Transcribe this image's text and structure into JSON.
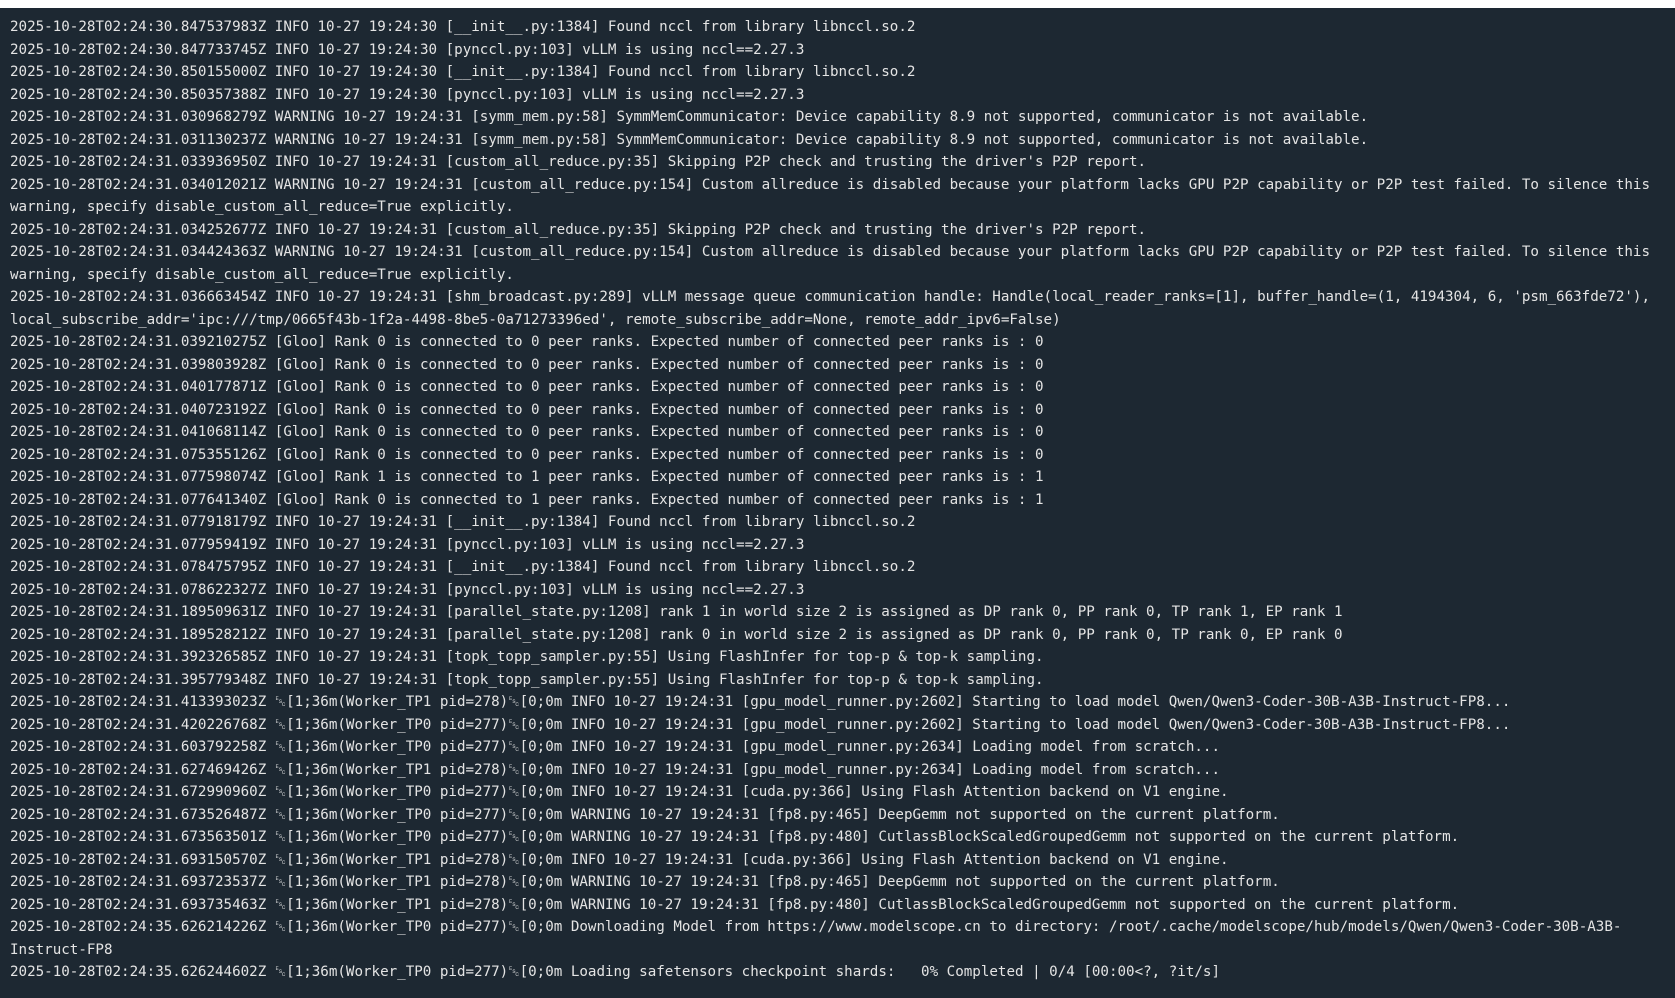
{
  "terminal": {
    "lines": [
      "2025-10-28T02:24:30.847537983Z INFO 10-27 19:24:30 [__init__.py:1384] Found nccl from library libnccl.so.2",
      "2025-10-28T02:24:30.847733745Z INFO 10-27 19:24:30 [pynccl.py:103] vLLM is using nccl==2.27.3",
      "2025-10-28T02:24:30.850155000Z INFO 10-27 19:24:30 [__init__.py:1384] Found nccl from library libnccl.so.2",
      "2025-10-28T02:24:30.850357388Z INFO 10-27 19:24:30 [pynccl.py:103] vLLM is using nccl==2.27.3",
      "2025-10-28T02:24:31.030968279Z WARNING 10-27 19:24:31 [symm_mem.py:58] SymmMemCommunicator: Device capability 8.9 not supported, communicator is not available.",
      "2025-10-28T02:24:31.031130237Z WARNING 10-27 19:24:31 [symm_mem.py:58] SymmMemCommunicator: Device capability 8.9 not supported, communicator is not available.",
      "2025-10-28T02:24:31.033936950Z INFO 10-27 19:24:31 [custom_all_reduce.py:35] Skipping P2P check and trusting the driver's P2P report.",
      "2025-10-28T02:24:31.034012021Z WARNING 10-27 19:24:31 [custom_all_reduce.py:154] Custom allreduce is disabled because your platform lacks GPU P2P capability or P2P test failed. To silence this",
      "warning, specify disable_custom_all_reduce=True explicitly.",
      "2025-10-28T02:24:31.034252677Z INFO 10-27 19:24:31 [custom_all_reduce.py:35] Skipping P2P check and trusting the driver's P2P report.",
      "2025-10-28T02:24:31.034424363Z WARNING 10-27 19:24:31 [custom_all_reduce.py:154] Custom allreduce is disabled because your platform lacks GPU P2P capability or P2P test failed. To silence this",
      "warning, specify disable_custom_all_reduce=True explicitly.",
      "2025-10-28T02:24:31.036663454Z INFO 10-27 19:24:31 [shm_broadcast.py:289] vLLM message queue communication handle: Handle(local_reader_ranks=[1], buffer_handle=(1, 4194304, 6, 'psm_663fde72'),",
      "local_subscribe_addr='ipc:///tmp/0665f43b-1f2a-4498-8be5-0a71273396ed', remote_subscribe_addr=None, remote_addr_ipv6=False)",
      "2025-10-28T02:24:31.039210275Z [Gloo] Rank 0 is connected to 0 peer ranks. Expected number of connected peer ranks is : 0",
      "2025-10-28T02:24:31.039803928Z [Gloo] Rank 0 is connected to 0 peer ranks. Expected number of connected peer ranks is : 0",
      "2025-10-28T02:24:31.040177871Z [Gloo] Rank 0 is connected to 0 peer ranks. Expected number of connected peer ranks is : 0",
      "2025-10-28T02:24:31.040723192Z [Gloo] Rank 0 is connected to 0 peer ranks. Expected number of connected peer ranks is : 0",
      "2025-10-28T02:24:31.041068114Z [Gloo] Rank 0 is connected to 0 peer ranks. Expected number of connected peer ranks is : 0",
      "2025-10-28T02:24:31.075355126Z [Gloo] Rank 0 is connected to 0 peer ranks. Expected number of connected peer ranks is : 0",
      "2025-10-28T02:24:31.077598074Z [Gloo] Rank 1 is connected to 1 peer ranks. Expected number of connected peer ranks is : 1",
      "2025-10-28T02:24:31.077641340Z [Gloo] Rank 0 is connected to 1 peer ranks. Expected number of connected peer ranks is : 1",
      "2025-10-28T02:24:31.077918179Z INFO 10-27 19:24:31 [__init__.py:1384] Found nccl from library libnccl.so.2",
      "2025-10-28T02:24:31.077959419Z INFO 10-27 19:24:31 [pynccl.py:103] vLLM is using nccl==2.27.3",
      "2025-10-28T02:24:31.078475795Z INFO 10-27 19:24:31 [__init__.py:1384] Found nccl from library libnccl.so.2",
      "2025-10-28T02:24:31.078622327Z INFO 10-27 19:24:31 [pynccl.py:103] vLLM is using nccl==2.27.3",
      "2025-10-28T02:24:31.189509631Z INFO 10-27 19:24:31 [parallel_state.py:1208] rank 1 in world size 2 is assigned as DP rank 0, PP rank 0, TP rank 1, EP rank 1",
      "2025-10-28T02:24:31.189528212Z INFO 10-27 19:24:31 [parallel_state.py:1208] rank 0 in world size 2 is assigned as DP rank 0, PP rank 0, TP rank 0, EP rank 0",
      "2025-10-28T02:24:31.392326585Z INFO 10-27 19:24:31 [topk_topp_sampler.py:55] Using FlashInfer for top-p & top-k sampling.",
      "2025-10-28T02:24:31.395779348Z INFO 10-27 19:24:31 [topk_topp_sampler.py:55] Using FlashInfer for top-p & top-k sampling.",
      "2025-10-28T02:24:31.413393023Z ␛[1;36m(Worker_TP1 pid=278)␛[0;0m INFO 10-27 19:24:31 [gpu_model_runner.py:2602] Starting to load model Qwen/Qwen3-Coder-30B-A3B-Instruct-FP8...",
      "2025-10-28T02:24:31.420226768Z ␛[1;36m(Worker_TP0 pid=277)␛[0;0m INFO 10-27 19:24:31 [gpu_model_runner.py:2602] Starting to load model Qwen/Qwen3-Coder-30B-A3B-Instruct-FP8...",
      "2025-10-28T02:24:31.603792258Z ␛[1;36m(Worker_TP0 pid=277)␛[0;0m INFO 10-27 19:24:31 [gpu_model_runner.py:2634] Loading model from scratch...",
      "2025-10-28T02:24:31.627469426Z ␛[1;36m(Worker_TP1 pid=278)␛[0;0m INFO 10-27 19:24:31 [gpu_model_runner.py:2634] Loading model from scratch...",
      "2025-10-28T02:24:31.672990960Z ␛[1;36m(Worker_TP0 pid=277)␛[0;0m INFO 10-27 19:24:31 [cuda.py:366] Using Flash Attention backend on V1 engine.",
      "2025-10-28T02:24:31.673526487Z ␛[1;36m(Worker_TP0 pid=277)␛[0;0m WARNING 10-27 19:24:31 [fp8.py:465] DeepGemm not supported on the current platform.",
      "2025-10-28T02:24:31.673563501Z ␛[1;36m(Worker_TP0 pid=277)␛[0;0m WARNING 10-27 19:24:31 [fp8.py:480] CutlassBlockScaledGroupedGemm not supported on the current platform.",
      "2025-10-28T02:24:31.693150570Z ␛[1;36m(Worker_TP1 pid=278)␛[0;0m INFO 10-27 19:24:31 [cuda.py:366] Using Flash Attention backend on V1 engine.",
      "2025-10-28T02:24:31.693723537Z ␛[1;36m(Worker_TP1 pid=278)␛[0;0m WARNING 10-27 19:24:31 [fp8.py:465] DeepGemm not supported on the current platform.",
      "2025-10-28T02:24:31.693735463Z ␛[1;36m(Worker_TP1 pid=278)␛[0;0m WARNING 10-27 19:24:31 [fp8.py:480] CutlassBlockScaledGroupedGemm not supported on the current platform.",
      "2025-10-28T02:24:35.626214226Z ␛[1;36m(Worker_TP0 pid=277)␛[0;0m Downloading Model from https://www.modelscope.cn to directory: /root/.cache/modelscope/hub/models/Qwen/Qwen3-Coder-30B-A3B-",
      "Instruct-FP8",
      "2025-10-28T02:24:35.626244602Z ␛[1;36m(Worker_TP0 pid=277)␛[0;0m Loading safetensors checkpoint shards:   0% Completed | 0/4 [00:00<?, ?it/s]"
    ]
  },
  "colors": {
    "background": "#1d2832",
    "text": "#e4e4e4"
  }
}
